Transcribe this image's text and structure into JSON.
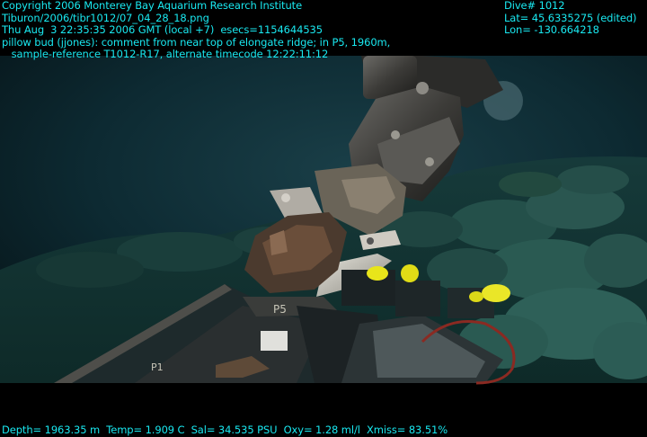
{
  "header_left": {
    "line1": "Copyright 2006 Monterey Bay Aquarium Research Institute",
    "line2": "Tiburon/2006/tibr1012/07_04_28_18.png",
    "line3": "Thu Aug  3 22:35:35 2006 GMT (local +7)  esecs=1154644535",
    "line4": "pillow bud (jjones): comment from near top of elongate ridge; in P5, 1960m,",
    "line5": "   sample-reference T1012-R17, alternate timecode 12:22:11:12"
  },
  "header_right": {
    "dive": "Dive# 1012",
    "lat": "Lat= 45.6335275 (edited)",
    "lon": "Lon= -130.664218"
  },
  "footer": {
    "telemetry": "Depth= 1963.35 m  Temp= 1.909 C  Sal= 34.535 PSU  Oxy= 1.28 ml/l  Xmiss= 83.51%"
  },
  "scene_labels": {
    "box_p1": "P1",
    "box_p5": "P5"
  },
  "colors": {
    "overlay_text": "#19e8f0",
    "water": "#0c2b33",
    "seafloor": "#234a44",
    "sponge_yellow": "#e8e51a"
  }
}
